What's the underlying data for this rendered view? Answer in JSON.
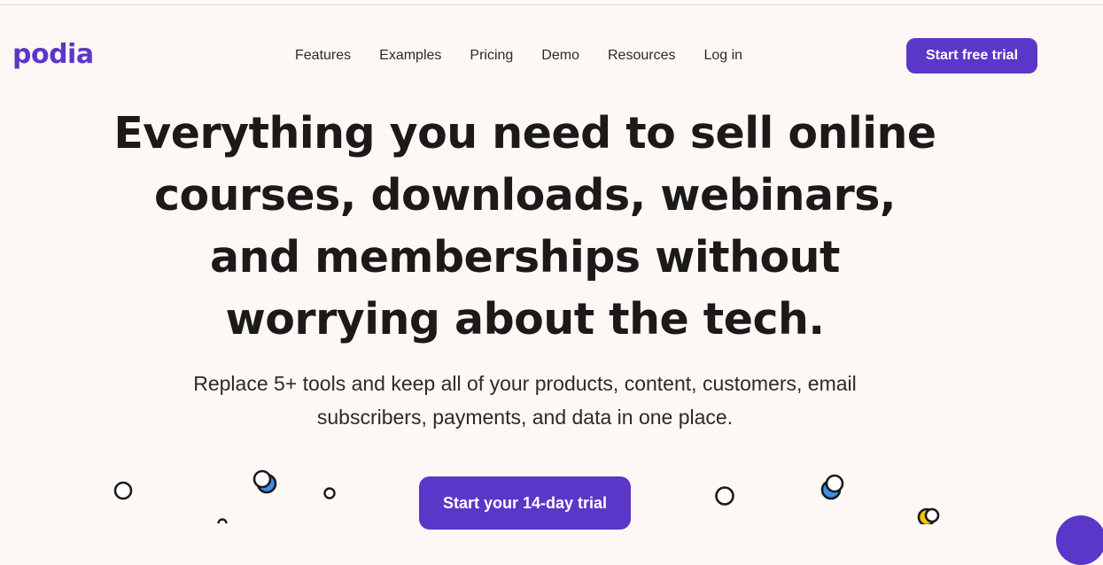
{
  "brand": {
    "name": "podia",
    "color": "#5a37c8"
  },
  "nav": {
    "items": [
      {
        "label": "Features"
      },
      {
        "label": "Examples"
      },
      {
        "label": "Pricing"
      },
      {
        "label": "Demo"
      },
      {
        "label": "Resources"
      },
      {
        "label": "Log in"
      }
    ],
    "cta_label": "Start free trial"
  },
  "hero": {
    "lines": [
      "Everything you need to sell online",
      "courses, downloads, webinars,",
      "and memberships without",
      "worrying about the tech."
    ],
    "subtitle_lines": [
      "Replace 5+ tools and keep all of your products, content, customers, email",
      "subscribers, payments, and data in one place."
    ],
    "cta_label": "Start your 14-day trial"
  },
  "colors": {
    "background": "#fdf8f5",
    "accent": "#5a37c8",
    "decor_blue": "#3b8fe8",
    "decor_yellow": "#f2c21b"
  },
  "icons": [
    "decorative-circle-icon",
    "chat-launcher-icon"
  ]
}
